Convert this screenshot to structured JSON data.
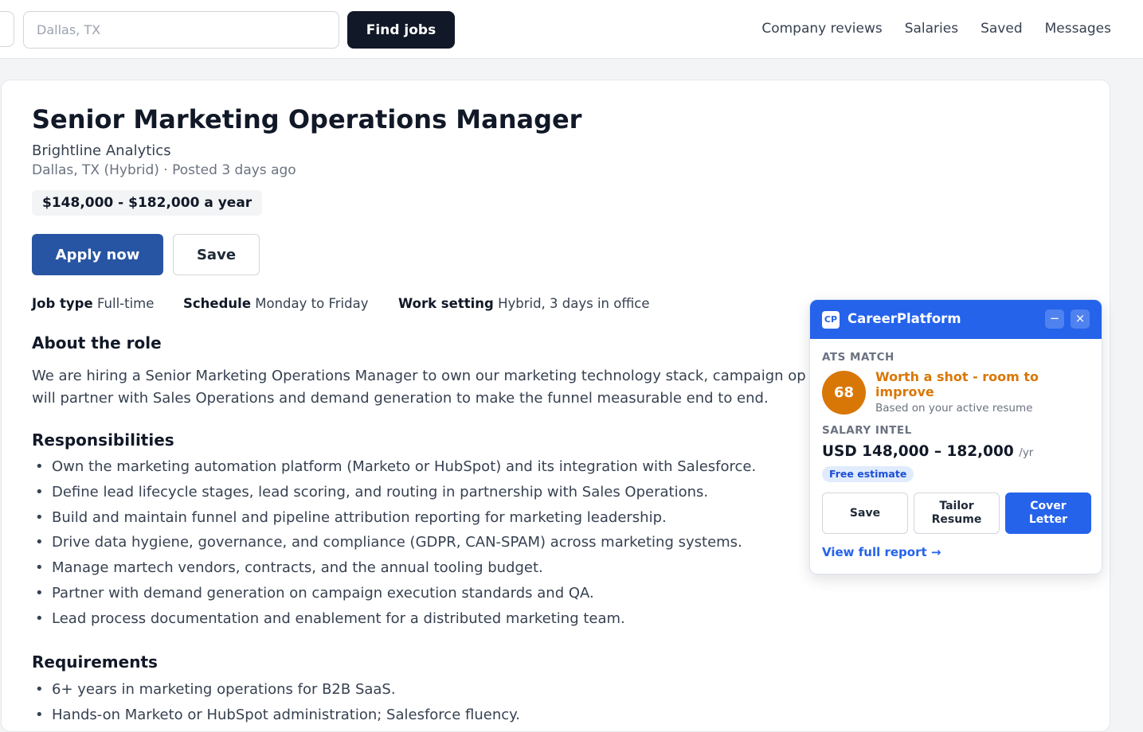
{
  "search": {
    "where_placeholder": "Dallas, TX",
    "find_label": "Find jobs"
  },
  "nav": [
    "Company reviews",
    "Salaries",
    "Saved",
    "Messages"
  ],
  "job": {
    "title": "Senior Marketing Operations Manager",
    "company": "Brightline Analytics",
    "location": "Dallas, TX (Hybrid)",
    "posted": "Posted 3 days ago",
    "salary": "$148,000 - $182,000 a year",
    "apply_label": "Apply now",
    "save_label": "Save",
    "facts": [
      {
        "label": "Job type",
        "value": "Full-time"
      },
      {
        "label": "Schedule",
        "value": "Monday to Friday"
      },
      {
        "label": "Work setting",
        "value": "Hybrid, 3 days in office"
      }
    ],
    "about_heading": "About the role",
    "about_line1": "We are hiring a Senior Marketing Operations Manager to own our marketing technology stack, campaign op",
    "about_line2": "will partner with Sales Operations and demand generation to make the funnel measurable end to end.",
    "responsibilities_heading": "Responsibilities",
    "responsibilities": [
      "Own the marketing automation platform (Marketo or HubSpot) and its integration with Salesforce.",
      "Define lead lifecycle stages, lead scoring, and routing in partnership with Sales Operations.",
      "Build and maintain funnel and pipeline attribution reporting for marketing leadership.",
      "Drive data hygiene, governance, and compliance (GDPR, CAN-SPAM) across marketing systems.",
      "Manage martech vendors, contracts, and the annual tooling budget.",
      "Partner with demand generation on campaign execution standards and QA.",
      "Lead process documentation and enablement for a distributed marketing team."
    ],
    "requirements_heading": "Requirements",
    "requirements": [
      "6+ years in marketing operations for B2B SaaS.",
      "Hands-on Marketo or HubSpot administration; Salesforce fluency."
    ]
  },
  "widget": {
    "logo_text": "CP",
    "title": "CareerPlatform",
    "minimize_icon": "−",
    "close_icon": "×",
    "ats_heading": "ATS MATCH",
    "score": "68",
    "verdict": "Worth a shot - room to improve",
    "basis": "Based on your active resume",
    "salary_heading": "SALARY INTEL",
    "salary_range": "USD 148,000 – 182,000",
    "salary_unit": "/yr",
    "badge": "Free estimate",
    "save_label": "Save",
    "tailor_label": "Tailor Resume",
    "cover_label": "Cover Letter",
    "report_link": "View full report →",
    "accent_color": "#2563eb",
    "score_color": "#d97706"
  }
}
